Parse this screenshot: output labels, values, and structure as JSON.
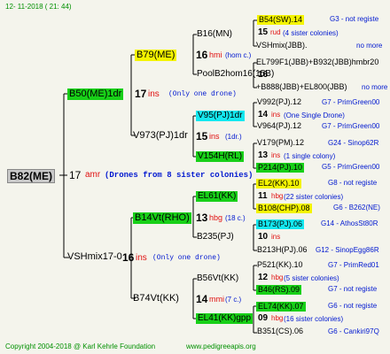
{
  "header": {
    "date": "12-  11-2018  ( 21: 44)"
  },
  "footer": {
    "copyright": "Copyright 2004-2018 @ Karl Kehrle Foundation",
    "url": "www.pedigreeapis.org"
  },
  "root": {
    "id": "B82(ME)",
    "num": "17",
    "tag": "amr",
    "note": "(Drones from 8 sister colonies)"
  },
  "g1": {
    "upper": {
      "id": "B50(ME)1dr",
      "num": "17",
      "tag": "ins",
      "note": "(Only one drone)"
    },
    "lower": {
      "id": "VSHmix17-0",
      "num": "16",
      "tag": "ins",
      "note": "(Only one drone)"
    }
  },
  "g2": {
    "a": {
      "id": "B79(ME)",
      "num": "16",
      "tag": "hmi",
      "note": "(hom c.)"
    },
    "b": {
      "id": "V973(PJ)1dr",
      "num": "15",
      "tag": "ins",
      "note": "(1dr.)"
    },
    "c": {
      "id": "B14Vt(RHO)",
      "num": "13",
      "tag": "hbg",
      "note": "(18 c.)"
    },
    "d": {
      "id": "B74Vt(KK)",
      "num": "14",
      "tag": "mmi",
      "note": "(7 c.)"
    }
  },
  "g3": {
    "a1": "B16(MN)",
    "a2": "PoolB2hom16(15B)",
    "b1": "V95(PJ)1dr",
    "b2": "V154H(RL)",
    "c1": "EL61(KK)",
    "c2": "B235(PJ)",
    "d1": "B56Vt(KK)",
    "d2": "EL41(KK)gpp"
  },
  "g4": {
    "r1": {
      "id": "B54(SW).14",
      "right": "G3 - not registe"
    },
    "r2": {
      "num": "15",
      "tag": "rud",
      "note": "(4 sister colonies)"
    },
    "r3": {
      "id": "VSHmix(JBB).",
      "right": "no more"
    },
    "r4": {
      "id": "EL799F1(JBB)+B932(JBB)hmbr20"
    },
    "r5": {
      "num": "16",
      "extra": "(15B)"
    },
    "r6": {
      "id": "+B888(JBB)+EL800(JBB)",
      "right": "no more"
    },
    "r7": {
      "id": "V992(PJ).12",
      "right": "G7 - PrimGreen00"
    },
    "r8": {
      "num": "14",
      "tag": "ins",
      "note": "(One Single Drone)"
    },
    "r9": {
      "id": "V964(PJ).12",
      "right": "G7 - PrimGreen00"
    },
    "r10": {
      "id": "V179(PM).12",
      "right": "G24 - Sinop62R"
    },
    "r11": {
      "num": "13",
      "tag": "ins",
      "note": "(1 single colony)"
    },
    "r12": {
      "id": "P214(PJ).10",
      "right": "G5 - PrimGreen00"
    },
    "r13": {
      "id": "EL2(KK).10",
      "right": "G8 - not registe"
    },
    "r14": {
      "num": "11",
      "tag": "hbg",
      "note": "(22 sister colonies)"
    },
    "r15": {
      "id": "B108(CHP).08",
      "right": "G6 - B262(NE)"
    },
    "r16": {
      "id": "B173(PJ).06",
      "right": "G14 - AthosSt80R"
    },
    "r17": {
      "num": "10",
      "tag": "ins"
    },
    "r18": {
      "id": "B213H(PJ).06",
      "right": "G12 - SinopEgg86R"
    },
    "r19": {
      "id": "P521(KK).10",
      "right": "G7 - PrimRed01"
    },
    "r20": {
      "num": "12",
      "tag": "hbg",
      "note": "(5 sister colonies)"
    },
    "r21": {
      "id": "B46(RS).09",
      "right": "G7 - not registe"
    },
    "r22": {
      "id": "EL74(KK).07",
      "right": "G6 - not registe"
    },
    "r23": {
      "num": "09",
      "tag": "hbg",
      "note": "(16 sister colonies)"
    },
    "r24": {
      "id": "B351(CS).06",
      "right": "G6 - Cankiri97Q"
    }
  }
}
